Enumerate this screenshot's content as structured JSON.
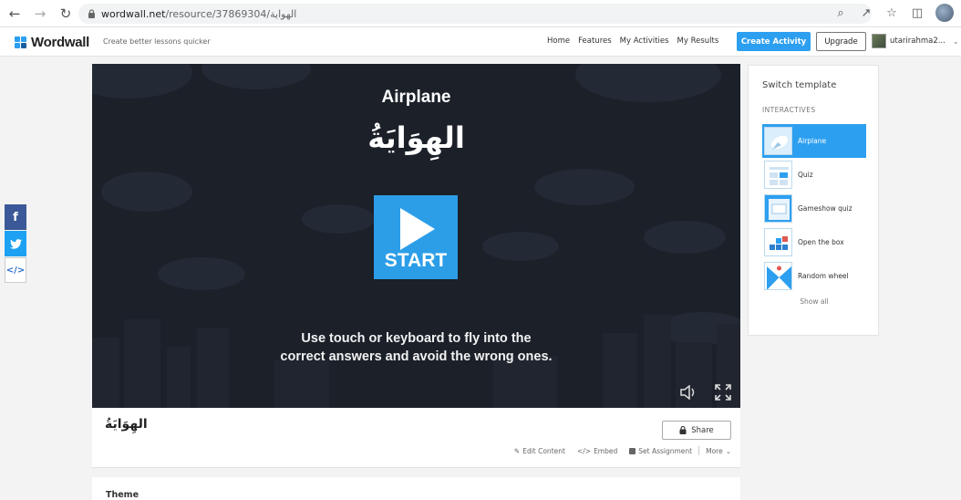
{
  "browser": {
    "url_host": "wordwall.net",
    "url_path": "/resource/37869304/الهواية"
  },
  "header": {
    "logo_text": "Wordwall",
    "tagline": "Create better lessons quicker",
    "nav": [
      "Home",
      "Features",
      "My Activities",
      "My Results"
    ],
    "create_label": "Create Activity",
    "upgrade_label": "Upgrade",
    "username": "utarirahma2...",
    "accent_color": "#2d9ff0"
  },
  "social": {
    "facebook": "f",
    "twitter": "t",
    "embed": "</>"
  },
  "game": {
    "title": "Airplane",
    "arabic_title": "الهِوَايَةُ",
    "start_label": "START",
    "instruction_line1": "Use touch or keyboard to fly into the",
    "instruction_line2": "correct answers and avoid the wrong ones.",
    "sound_icon": "speaker-icon",
    "fullscreen_icon": "fullscreen-icon"
  },
  "activity": {
    "name": "الهِوَايَةُ",
    "share_label": "Share",
    "actions": [
      "Edit Content",
      "Embed",
      "Set Assignment",
      "More"
    ]
  },
  "theme": {
    "label": "Theme"
  },
  "templates": {
    "title": "Switch template",
    "subtitle": "INTERACTIVES",
    "items": [
      {
        "label": "Airplane",
        "icon": "airplane-template-icon",
        "active": true
      },
      {
        "label": "Quiz",
        "icon": "quiz-template-icon",
        "active": false
      },
      {
        "label": "Gameshow quiz",
        "icon": "gameshow-template-icon",
        "active": false
      },
      {
        "label": "Open the box",
        "icon": "open-box-template-icon",
        "active": false
      },
      {
        "label": "Random wheel",
        "icon": "random-wheel-template-icon",
        "active": false
      }
    ],
    "show_all": "Show all"
  }
}
